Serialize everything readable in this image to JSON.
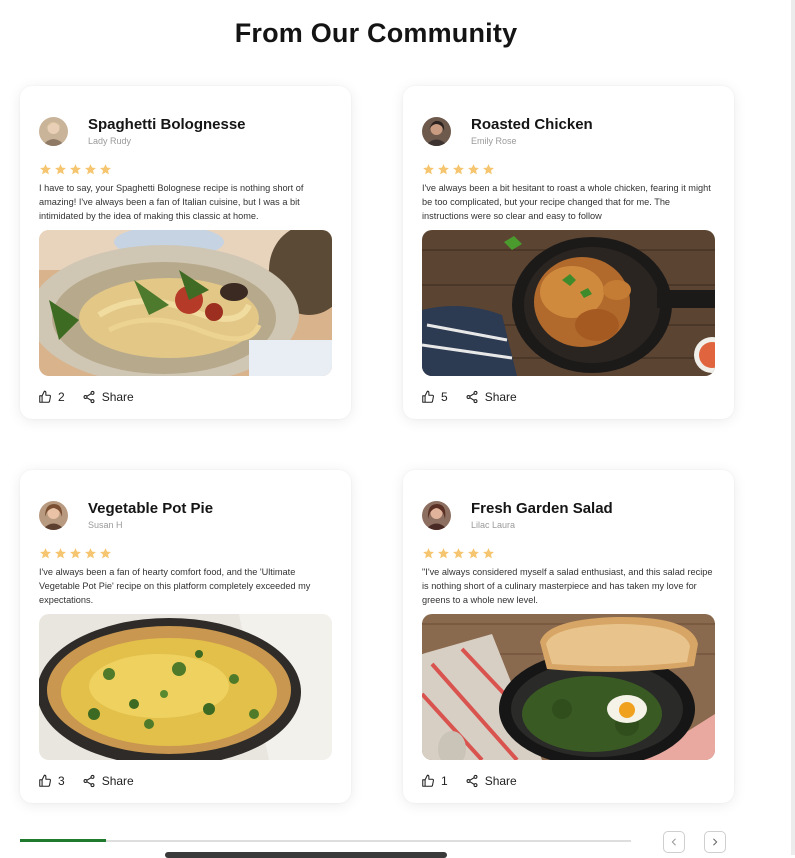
{
  "page": {
    "title": "From Our Community"
  },
  "icons": {
    "star": "star-icon",
    "like": "thumbs-up-icon",
    "share": "share-icon",
    "prev": "chevron-left-icon",
    "next": "chevron-right-icon"
  },
  "colors": {
    "star": "#f6c56f",
    "progress": "#1f7a2e"
  },
  "cards": [
    {
      "title": "Spaghetti Bolognesse",
      "author": "Lady Rudy",
      "rating": 5,
      "review": "I have to say, your Spaghetti Bolognese recipe is nothing short of amazing! I've always been a fan of Italian cuisine, but I was a bit intimidated by the idea of making this classic at home.",
      "likes": "2",
      "share_label": "Share"
    },
    {
      "title": "Roasted Chicken",
      "author": "Emily Rose",
      "rating": 5,
      "review": "I've always been a bit hesitant to roast a whole chicken, fearing it might be too complicated, but your recipe changed that for me. The instructions were so clear and easy to follow",
      "likes": "5",
      "share_label": "Share"
    },
    {
      "title": "Vegetable Pot Pie",
      "author": "Susan H",
      "rating": 5,
      "review": "I've always been a fan of hearty comfort food, and the 'Ultimate Vegetable Pot Pie' recipe on this platform completely exceeded my expectations.",
      "likes": "3",
      "share_label": "Share"
    },
    {
      "title": "Fresh Garden Salad",
      "author": "Lilac Laura",
      "rating": 5,
      "review": "\"I've always considered myself a salad enthusiast, and this salad recipe is nothing short of a culinary masterpiece and has taken my love for greens to a whole new level.",
      "likes": "1",
      "share_label": "Share"
    }
  ],
  "carousel": {
    "progress": 0.14
  }
}
